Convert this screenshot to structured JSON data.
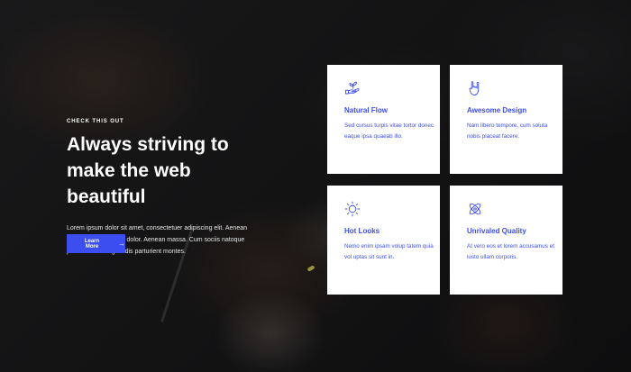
{
  "hero": {
    "eyebrow": "CHECK THIS OUT",
    "headline": "Always striving to make the web beautiful",
    "paragraph": "Lorem ipsum dolor sit amet, consectetuer adipiscing elit. Aenean commodo ligula eget dolor. Aenean massa. Cum sociis natoque penatibus et magnis dis parturient montes.",
    "button_label": "Learn More",
    "button_icon": "arrow-right-icon"
  },
  "colors": {
    "accent": "#3d4ef0",
    "card_background": "#ffffff",
    "page_background": "#141414"
  },
  "features": [
    {
      "icon": "hand-plant-icon",
      "title": "Natural Flow",
      "text": "Sed cursus turpis vitae tortor donec eaque ipsa quaeab illo."
    },
    {
      "icon": "rock-hand-icon",
      "title": "Awesome Design",
      "text": "Nam libero tempore, cum soluta nobis placeat facere."
    },
    {
      "icon": "sun-icon",
      "title": "Hot Looks",
      "text": "Nemo enim ipsam volup tatem quia vol uptas sit sunt in."
    },
    {
      "icon": "atom-icon",
      "title": "Unrivaled Quality",
      "text": "At vero eos et lorem accusamus et iusto ullam corporis."
    }
  ]
}
